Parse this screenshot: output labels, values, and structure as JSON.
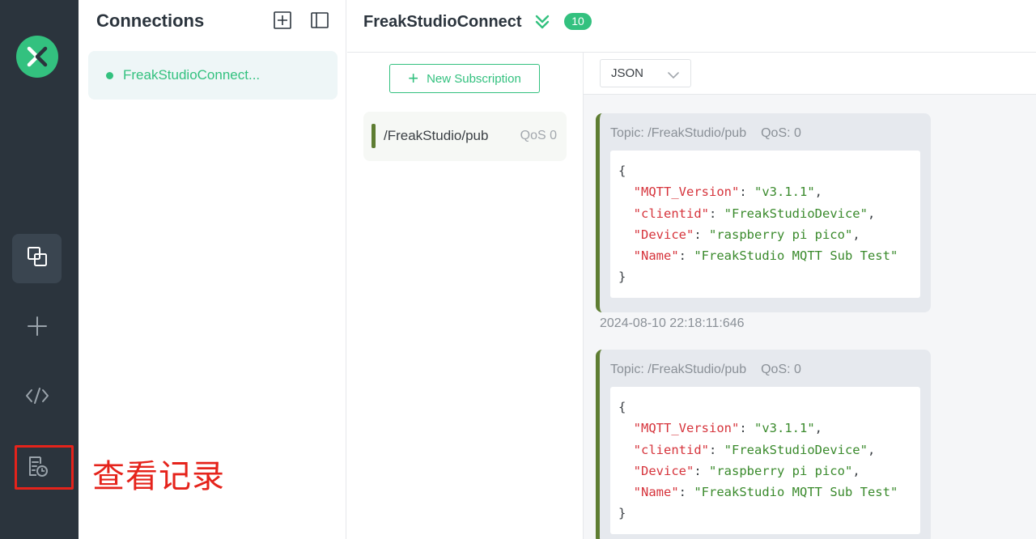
{
  "sidebar": {
    "logo_icon": "mqttx-logo-icon",
    "items": [
      {
        "icon": "connections-icon",
        "active": true
      },
      {
        "icon": "plus-icon",
        "active": false
      },
      {
        "icon": "code-icon",
        "active": false
      },
      {
        "icon": "log-history-icon",
        "active": false
      }
    ],
    "annotation": "查看记录"
  },
  "connections": {
    "title": "Connections",
    "list": [
      {
        "name": "FreakStudioConnect...",
        "status_color": "#33c17f"
      }
    ]
  },
  "header": {
    "title": "FreakStudioConnect",
    "badge": "10"
  },
  "subscriptions": {
    "new_button": "New Subscription",
    "items": [
      {
        "topic": "/FreakStudio/pub",
        "qos": "QoS 0",
        "color": "#5e7d32"
      }
    ]
  },
  "messages": {
    "format": "JSON",
    "list": [
      {
        "topic": "Topic: /FreakStudio/pub",
        "qos": "QoS: 0",
        "fields": [
          {
            "key": "\"MQTT_Version\"",
            "value": "\"v3.1.1\"",
            "sep": ","
          },
          {
            "key": "\"clientid\"",
            "value": "\"FreakStudioDevice\"",
            "sep": ","
          },
          {
            "key": "\"Device\"",
            "value": "\"raspberry pi pico\"",
            "sep": ","
          },
          {
            "key": "\"Name\"",
            "value": "\"FreakStudio MQTT Sub Test\"",
            "sep": ""
          }
        ],
        "time": "2024-08-10 22:18:11:646"
      },
      {
        "topic": "Topic: /FreakStudio/pub",
        "qos": "QoS: 0",
        "fields": [
          {
            "key": "\"MQTT_Version\"",
            "value": "\"v3.1.1\"",
            "sep": ","
          },
          {
            "key": "\"clientid\"",
            "value": "\"FreakStudioDevice\"",
            "sep": ","
          },
          {
            "key": "\"Device\"",
            "value": "\"raspberry pi pico\"",
            "sep": ","
          },
          {
            "key": "\"Name\"",
            "value": "\"FreakStudio MQTT Sub Test\"",
            "sep": ""
          }
        ]
      }
    ]
  },
  "colors": {
    "accent": "#33c17f",
    "rail": "#2b343d",
    "topic_bar": "#5e7d32",
    "annotation": "#e5231b"
  }
}
